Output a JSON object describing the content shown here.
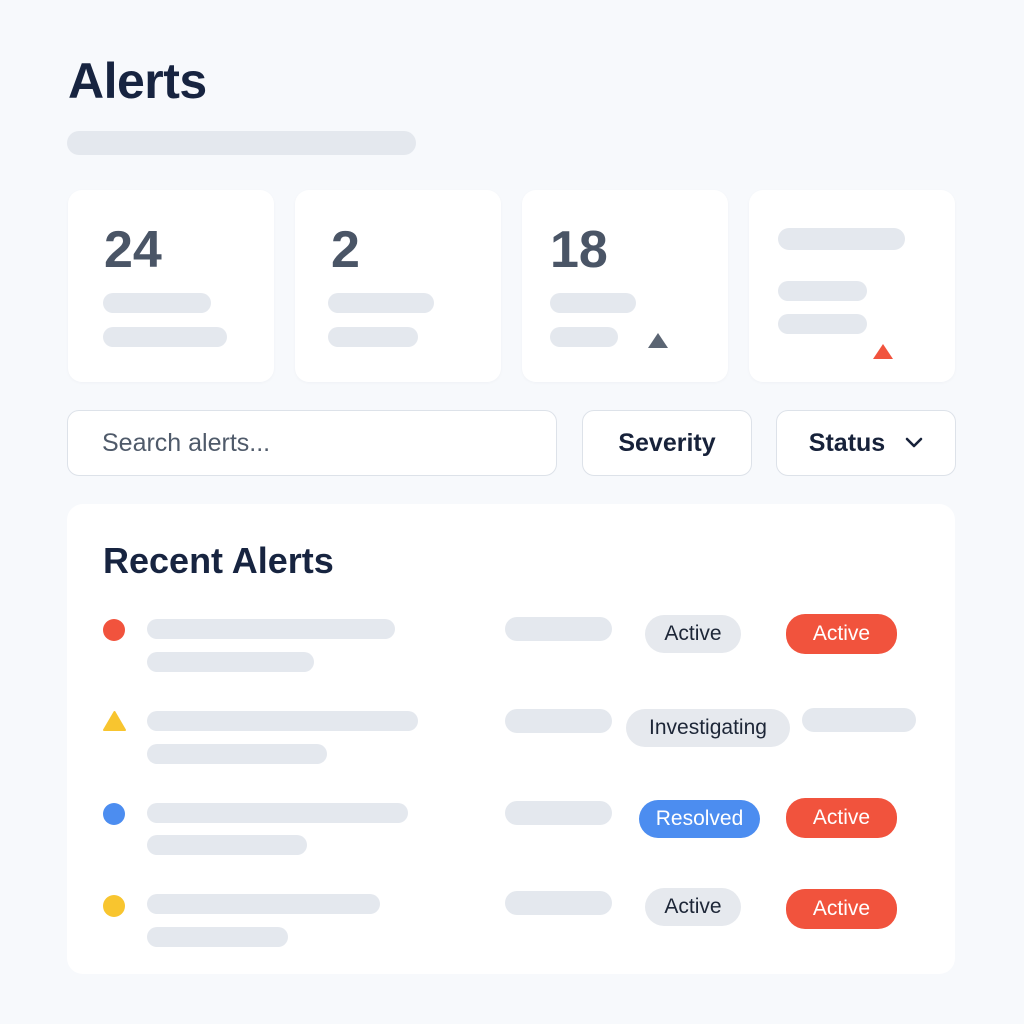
{
  "page": {
    "title": "Alerts"
  },
  "stats": [
    {
      "value": "24"
    },
    {
      "value": "2"
    },
    {
      "value": "18",
      "trend_icon": "triangle-up-icon"
    },
    {
      "value": "",
      "trend_icon": "triangle-up-icon"
    }
  ],
  "filters": {
    "search_placeholder": "Search alerts...",
    "severity_label": "Severity",
    "status_label": "Status",
    "status_icon": "chevron-down-icon"
  },
  "recent": {
    "title": "Recent Alerts",
    "rows": [
      {
        "severity_icon": "red-dot-icon",
        "status": "Active",
        "state": "Active"
      },
      {
        "severity_icon": "yellow-triangle-icon",
        "status": "Investigating",
        "state": ""
      },
      {
        "severity_icon": "blue-dot-icon",
        "status": "Resolved",
        "state": "Active"
      },
      {
        "severity_icon": "yellow-dot-icon",
        "status": "Active",
        "state": "Active"
      }
    ]
  },
  "colors": {
    "critical": "#f1533d",
    "warning": "#f8c52f",
    "info": "#4c8df0",
    "neutral_pill": "#e6e9ee"
  }
}
